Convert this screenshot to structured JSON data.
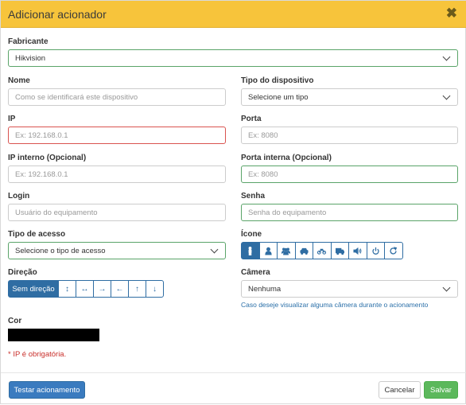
{
  "modal": {
    "title": "Adicionar acionador",
    "close_glyph": "✖"
  },
  "fabricante": {
    "label": "Fabricante",
    "value": "Hikvision"
  },
  "nome": {
    "label": "Nome",
    "placeholder": "Como se identificará este dispositivo"
  },
  "tipo_dispositivo": {
    "label": "Tipo do dispositivo",
    "value": "Selecione um tipo"
  },
  "ip": {
    "label": "IP",
    "placeholder": "Ex: 192.168.0.1"
  },
  "porta": {
    "label": "Porta",
    "placeholder": "Ex: 8080"
  },
  "ip_interno": {
    "label": "IP interno (Opcional)",
    "placeholder": "Ex: 192.168.0.1"
  },
  "porta_interna": {
    "label": "Porta interna (Opcional)",
    "placeholder": "Ex: 8080"
  },
  "login": {
    "label": "Login",
    "placeholder": "Usuário do equipamento"
  },
  "senha": {
    "label": "Senha",
    "placeholder": "Senha do equipamento"
  },
  "tipo_acesso": {
    "label": "Tipo de acesso",
    "value": "Selecione o tipo de acesso"
  },
  "icone": {
    "label": "Ícone",
    "options": [
      "person-icon",
      "user-icon",
      "group-icon",
      "car-icon",
      "motorcycle-icon",
      "truck-icon",
      "speaker-icon",
      "power-icon",
      "refresh-icon"
    ],
    "selected": "person-icon"
  },
  "direcao": {
    "label": "Direção",
    "options": [
      {
        "name": "sem-direcao",
        "label": "Sem direção"
      },
      {
        "name": "vertical",
        "glyph": "↕"
      },
      {
        "name": "horizontal",
        "glyph": "↔"
      },
      {
        "name": "right",
        "glyph": "→"
      },
      {
        "name": "left",
        "glyph": "←"
      },
      {
        "name": "up",
        "glyph": "↑"
      },
      {
        "name": "down",
        "glyph": "↓"
      }
    ],
    "selected": "sem-direcao"
  },
  "camera": {
    "label": "Câmera",
    "value": "Nenhuma",
    "helper": "Caso deseje visualizar alguma câmera durante o acionamento"
  },
  "cor": {
    "label": "Cor",
    "value": "#000000"
  },
  "validation": {
    "ip_required": "* IP é obrigatória."
  },
  "footer": {
    "test_label": "Testar acionamento",
    "cancel_label": "Cancelar",
    "save_label": "Salvar"
  },
  "colors": {
    "header": "#f7c43b",
    "primary": "#2f6da3",
    "success": "#5cb85c",
    "error": "#d9534f",
    "valid": "#5aa469"
  }
}
